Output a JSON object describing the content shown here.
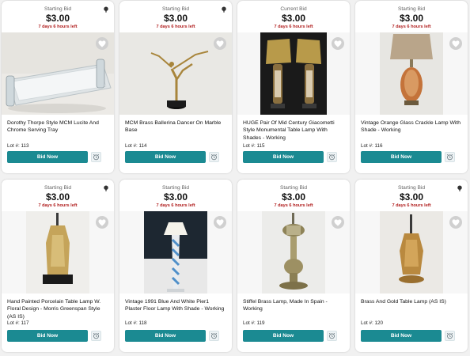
{
  "lots": [
    {
      "bid_label": "Starting Bid",
      "price": "$3.00",
      "time_left": "7 days 6 hours left",
      "title": "Dorothy Thorpe Style MCM Lucite And Chrome Serving Tray",
      "lot": "Lot #: 113",
      "bid_button": "Bid Now"
    },
    {
      "bid_label": "Starting Bid",
      "price": "$3.00",
      "time_left": "7 days 6 hours left",
      "title": "MCM Brass Ballerina Dancer On Marble Base",
      "lot": "Lot #: 114",
      "bid_button": "Bid Now"
    },
    {
      "bid_label": "Current Bid",
      "price": "$3.00",
      "time_left": "7 days 6 hours left",
      "title": "HUGE Pair Of Mid Century Giacometti Style Monumental Table Lamp With Shades - Working",
      "lot": "Lot #: 115",
      "bid_button": "Bid Now"
    },
    {
      "bid_label": "Starting Bid",
      "price": "$3.00",
      "time_left": "7 days 6 hours left",
      "title": "Vintage Orange Glass Crackle Lamp With Shade - Working",
      "lot": "Lot #: 116",
      "bid_button": "Bid Now"
    },
    {
      "bid_label": "Starting Bid",
      "price": "$3.00",
      "time_left": "7 days 6 hours left",
      "title": "Hand Painted Porcelain Table Lamp W. Floral Design - Morris Greenspan Style (AS IS)",
      "lot": "Lot #: 117",
      "bid_button": "Bid Now"
    },
    {
      "bid_label": "Starting Bid",
      "price": "$3.00",
      "time_left": "7 days 6 hours left",
      "title": "Vintage 1991 Blue And White Pier1 Plaster Floor Lamp With Shade - Working",
      "lot": "Lot #: 118",
      "bid_button": "Bid Now"
    },
    {
      "bid_label": "Starting Bid",
      "price": "$3.00",
      "time_left": "7 days 6 hours left",
      "title": "Stiffel Brass Lamp, Made In Spain - Working",
      "lot": "Lot #: 119",
      "bid_button": "Bid Now"
    },
    {
      "bid_label": "Starting Bid",
      "price": "$3.00",
      "time_left": "7 days 6 hours left",
      "title": "Brass And Gold Table Lamp (AS IS)",
      "lot": "Lot #: 120",
      "bid_button": "Bid Now"
    }
  ],
  "colors": {
    "bid_button": "#1b8a92",
    "time_left": "#b01d1d",
    "heart_bg": "#d0d0d0"
  },
  "icons": {
    "paddle": "auction-paddle-icon",
    "favorite": "heart-icon",
    "watch": "alarm-clock-icon"
  }
}
